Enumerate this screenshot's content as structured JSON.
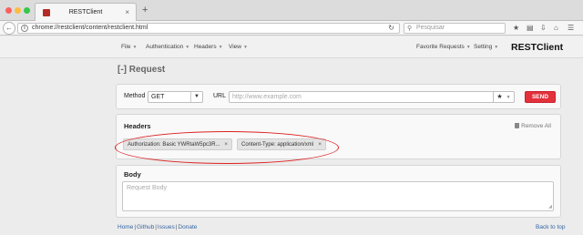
{
  "browser": {
    "tab_title": "RESTClient",
    "tab_close": "×",
    "new_tab": "+",
    "url": "chrome://restclient/content/restclient.html",
    "search_placeholder": "Pesquisar",
    "icons": [
      "back-arrow-icon",
      "info-icon",
      "reload-icon",
      "search-icon",
      "star-icon",
      "reading-list-icon",
      "download-icon",
      "home-icon",
      "menu-icon"
    ]
  },
  "app": {
    "brand": "RESTClient",
    "menus": [
      {
        "label": "File"
      },
      {
        "label": "Authentication"
      },
      {
        "label": "Headers"
      },
      {
        "label": "View"
      }
    ],
    "right_menus": [
      {
        "label": "Favorite Requests"
      },
      {
        "label": "Setting"
      }
    ]
  },
  "request": {
    "title": "[-] Request",
    "method_label": "Method",
    "method_value": "GET",
    "url_label": "URL",
    "url_placeholder": "http://www.example.com",
    "favorite_symbol": "★",
    "send_label": "SEND"
  },
  "headers": {
    "title": "Headers",
    "remove_all_label": "Remove All",
    "tags": [
      {
        "text": "Authorization: Basic YWRtaW5pc3R...",
        "remove": "×"
      },
      {
        "text": "Content-Type: application/xml",
        "remove": "×"
      }
    ]
  },
  "body": {
    "title": "Body",
    "placeholder": "Request Body"
  },
  "footer": {
    "links": [
      "Home",
      "Github",
      "Issues",
      "Donate"
    ],
    "back_to_top": "Back to top"
  },
  "colors": {
    "send_button": "#e3313c",
    "annotation_oval": "#dd2222",
    "link": "#3465a4"
  }
}
